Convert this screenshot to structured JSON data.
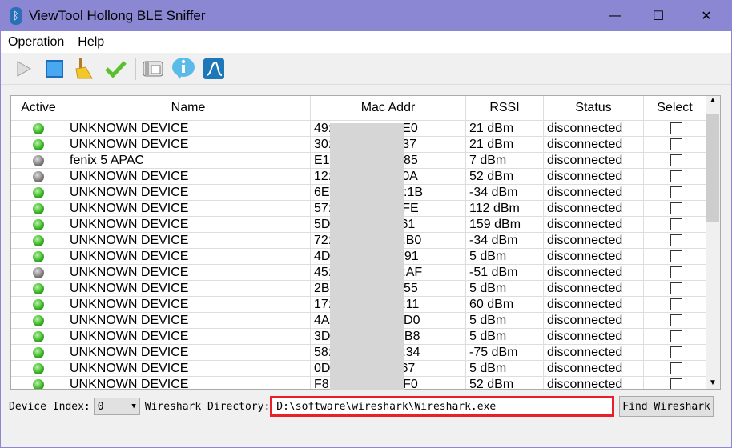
{
  "window": {
    "title": "ViewTool Hollong BLE Sniffer",
    "minimize": "—",
    "maximize": "☐",
    "close": "✕"
  },
  "menu": [
    "Operation",
    "Help"
  ],
  "toolbar": [
    "play-icon",
    "stop-icon",
    "broom-icon",
    "check-icon",
    "phone-icon",
    "info-icon",
    "wireshark-icon"
  ],
  "columns": [
    "Active",
    "Name",
    "Mac Addr",
    "RSSI",
    "Status",
    "Select"
  ],
  "rows": [
    {
      "active": "green",
      "name": "UNKNOWN DEVICE",
      "mac": "49:",
      "mac_end": "E0",
      "rssi": "21 dBm",
      "status": "disconnected"
    },
    {
      "active": "green",
      "name": "UNKNOWN DEVICE",
      "mac": "30:",
      "mac_end": "37",
      "rssi": "21 dBm",
      "status": "disconnected"
    },
    {
      "active": "gray",
      "name": "fenix 5 APAC",
      "mac": "E1:",
      "mac_end": "85",
      "rssi": "7 dBm",
      "status": "disconnected"
    },
    {
      "active": "gray",
      "name": "UNKNOWN DEVICE",
      "mac": "12:",
      "mac_end": "0A",
      "rssi": "52 dBm",
      "status": "disconnected"
    },
    {
      "active": "green",
      "name": "UNKNOWN DEVICE",
      "mac": "6E:",
      "mac_end": ":1B",
      "rssi": "-34 dBm",
      "status": "disconnected"
    },
    {
      "active": "green",
      "name": "UNKNOWN DEVICE",
      "mac": "57:",
      "mac_end": "FE",
      "rssi": "112 dBm",
      "status": "disconnected"
    },
    {
      "active": "green",
      "name": "UNKNOWN DEVICE",
      "mac": "5D",
      "mac_end": "61",
      "rssi": "159 dBm",
      "status": "disconnected"
    },
    {
      "active": "green",
      "name": "UNKNOWN DEVICE",
      "mac": "72:",
      "mac_end": ":B0",
      "rssi": "-34 dBm",
      "status": "disconnected"
    },
    {
      "active": "green",
      "name": "UNKNOWN DEVICE",
      "mac": "4D",
      "mac_end": ":91",
      "rssi": "5 dBm",
      "status": "disconnected"
    },
    {
      "active": "gray",
      "name": "UNKNOWN DEVICE",
      "mac": "45:",
      "mac_end": ":AF",
      "rssi": "-51 dBm",
      "status": "disconnected"
    },
    {
      "active": "green",
      "name": "UNKNOWN DEVICE",
      "mac": "2B:",
      "mac_end": "55",
      "rssi": "5 dBm",
      "status": "disconnected"
    },
    {
      "active": "green",
      "name": "UNKNOWN DEVICE",
      "mac": "17:",
      "mac_end": ":11",
      "rssi": "60 dBm",
      "status": "disconnected"
    },
    {
      "active": "green",
      "name": "UNKNOWN DEVICE",
      "mac": "4A",
      "mac_end": ":D0",
      "rssi": "5 dBm",
      "status": "disconnected"
    },
    {
      "active": "green",
      "name": "UNKNOWN DEVICE",
      "mac": "3D",
      "mac_end": ":B8",
      "rssi": "5 dBm",
      "status": "disconnected"
    },
    {
      "active": "green",
      "name": "UNKNOWN DEVICE",
      "mac": "58:",
      "mac_end": ":34",
      "rssi": "-75 dBm",
      "status": "disconnected"
    },
    {
      "active": "green",
      "name": "UNKNOWN DEVICE",
      "mac": "0D",
      "mac_end": "67",
      "rssi": "5 dBm",
      "status": "disconnected"
    },
    {
      "active": "green",
      "name": "UNKNOWN DEVICE",
      "mac": "F8:",
      "mac_end": "F0",
      "rssi": "52 dBm",
      "status": "disconnected"
    }
  ],
  "bottom": {
    "device_index_label": "Device Index:",
    "device_index": "0",
    "wireshark_label": "Wireshark Directory:",
    "wireshark_path": "D:\\software\\wireshark\\Wireshark.exe",
    "find_button": "Find Wireshark"
  }
}
